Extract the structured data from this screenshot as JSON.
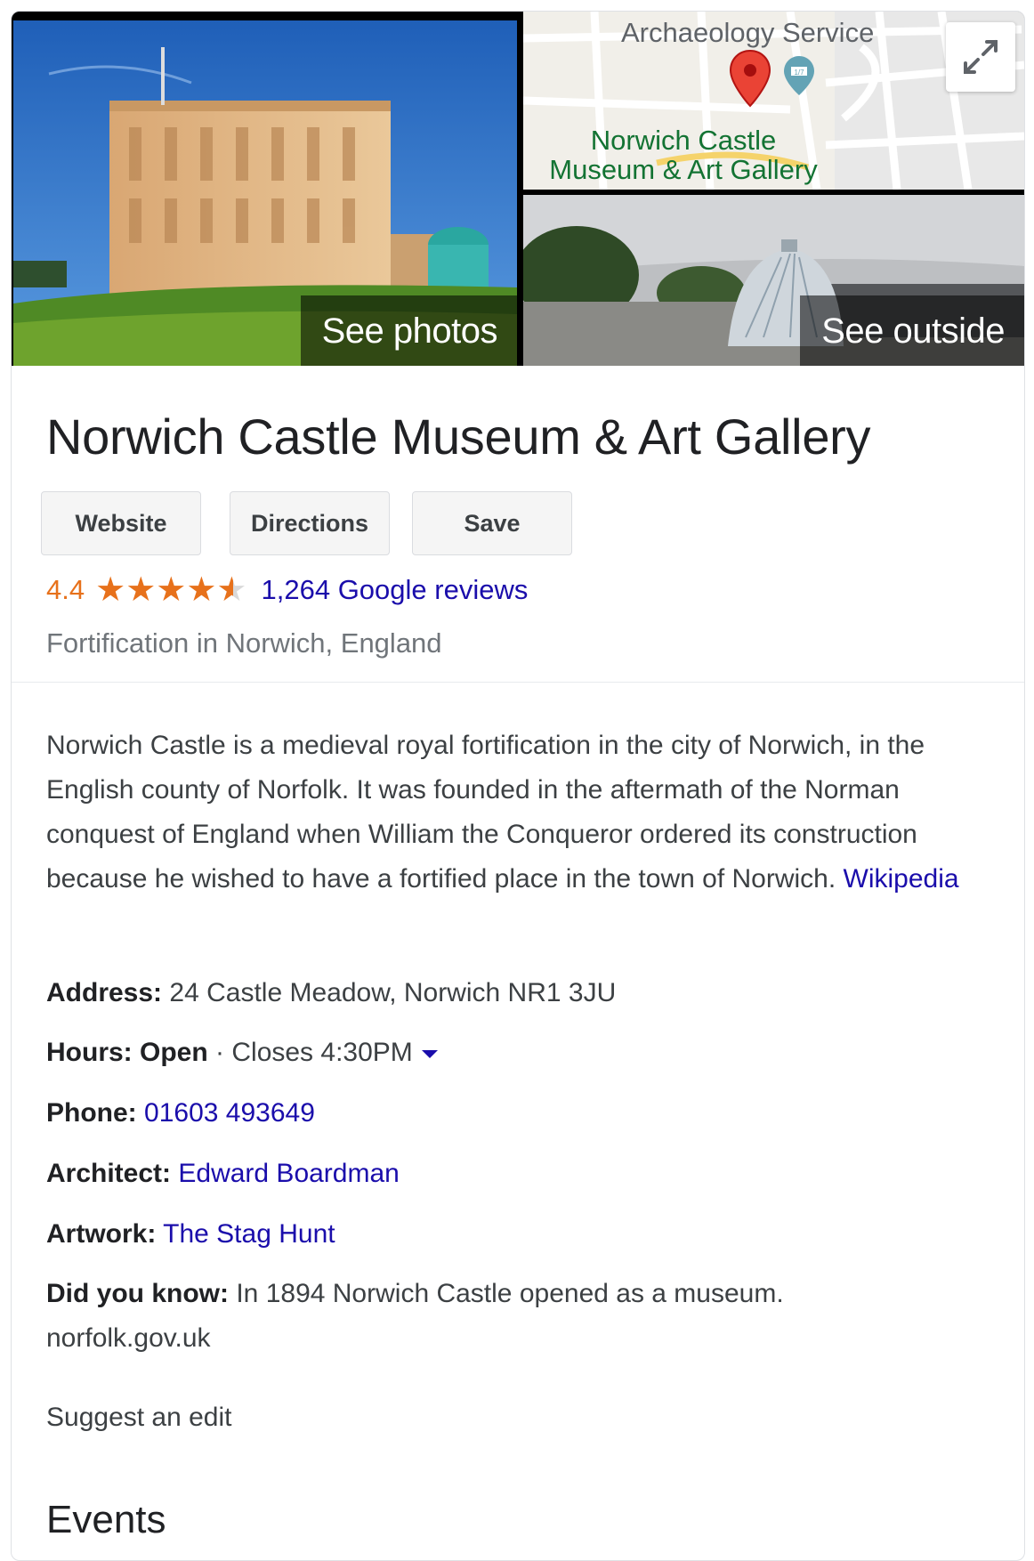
{
  "hero": {
    "see_photos": "See photos",
    "see_outside": "See outside"
  },
  "map": {
    "label_top": "Archaeology Service",
    "place_line1": "Norwich Castle",
    "place_line2": "Museum & Art Gallery",
    "poi_badge": "1/7",
    "pin_color": "#ea4335"
  },
  "place": {
    "title": "Norwich Castle Museum & Art Gallery",
    "buttons": [
      "Website",
      "Directions",
      "Save"
    ],
    "rating": "4.4",
    "rating_value": 4.4,
    "reviews": "1,264 Google reviews",
    "category": "Fortification in Norwich, England"
  },
  "description": {
    "text": "Norwich Castle is a medieval royal fortification in the city of Norwich, in the English county of Norfolk. It was founded in the aftermath of the Norman conquest of England when William the Conqueror ordered its construction because he wished to have a fortified place in the town of Norwich.",
    "source": "Wikipedia"
  },
  "facts": {
    "address_label": "Address:",
    "address_value": "24 Castle Meadow, Norwich NR1 3JU",
    "hours_label": "Hours:",
    "hours_status": "Open",
    "hours_sep": " · ",
    "hours_value": "Closes 4:30PM",
    "phone_label": "Phone:",
    "phone_value": "01603 493649",
    "architect_label": "Architect:",
    "architect_value": "Edward Boardman",
    "artwork_label": "Artwork:",
    "artwork_value": "The Stag Hunt",
    "didyouknow_label": "Did you know:",
    "didyouknow_value": "In 1894 Norwich Castle opened as a museum.",
    "didyouknow_source": "norfolk.gov.uk"
  },
  "suggest_edit": "Suggest an edit",
  "events_heading": "Events",
  "colors": {
    "accent_star": "#e7711b",
    "link": "#1a0dab",
    "map_place_text": "#137333"
  }
}
